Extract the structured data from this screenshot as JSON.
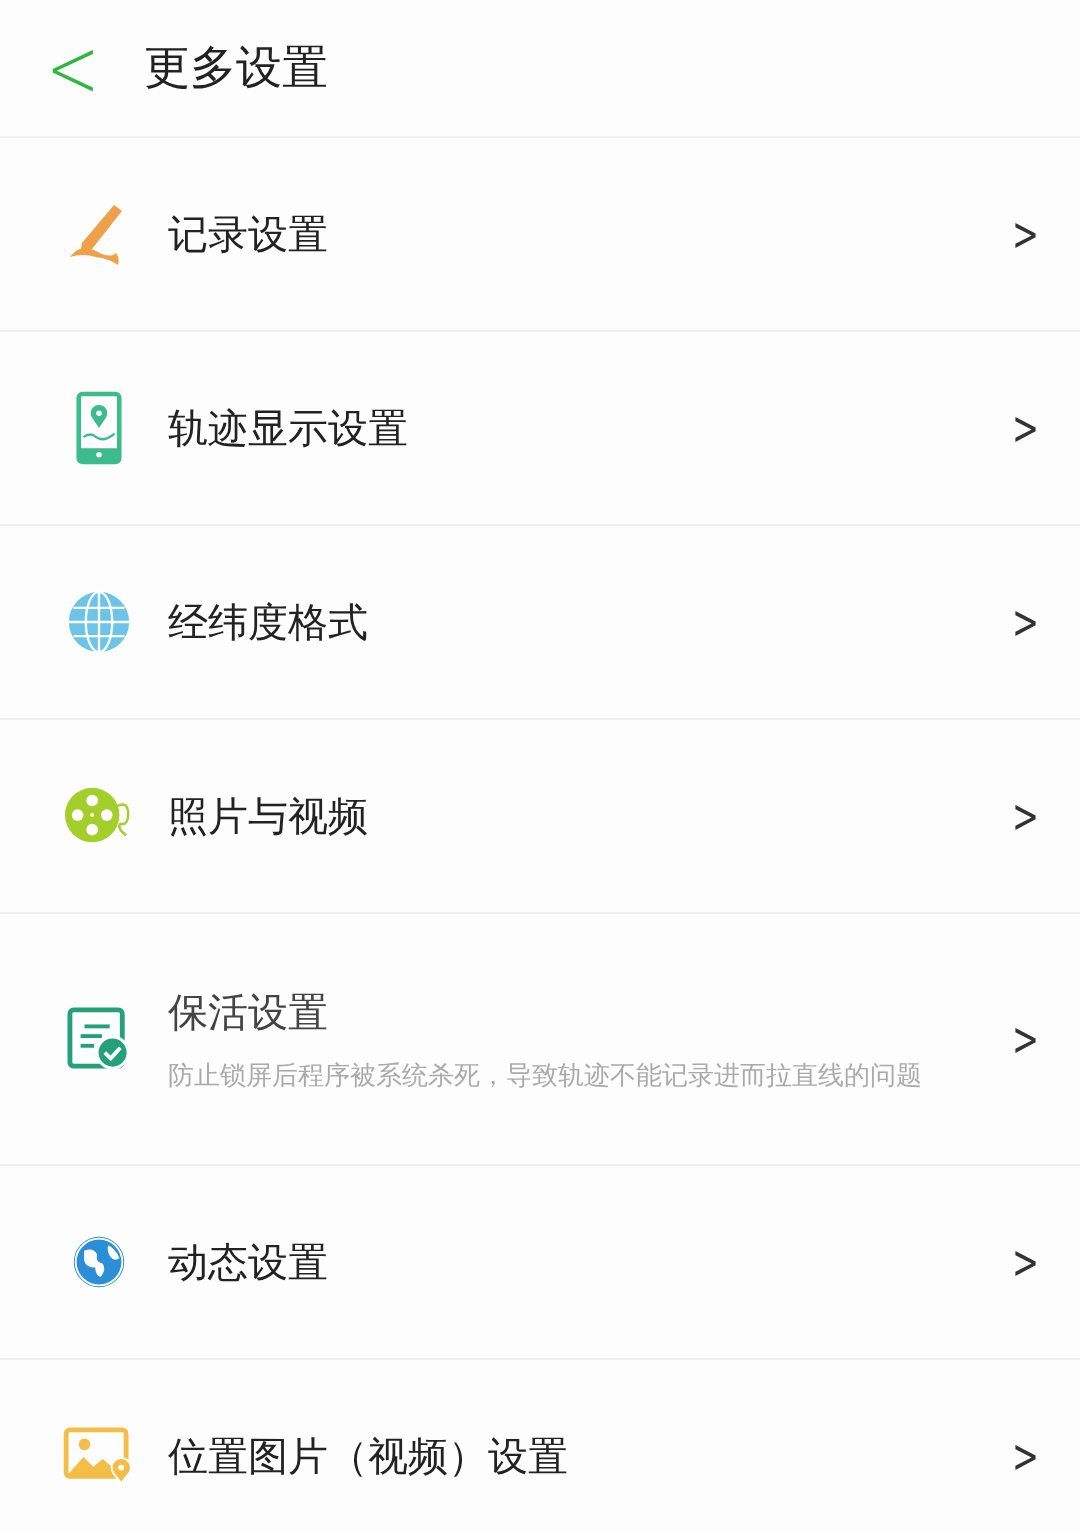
{
  "header": {
    "back": "<",
    "title": "更多设置"
  },
  "items": [
    {
      "kind": "record",
      "label": "记录设置",
      "chevron": ">"
    },
    {
      "kind": "track",
      "label": "轨迹显示设置",
      "chevron": ">"
    },
    {
      "kind": "coords",
      "label": "经纬度格式",
      "chevron": ">"
    },
    {
      "kind": "media",
      "label": "照片与视频",
      "chevron": ">"
    },
    {
      "kind": "keepalive",
      "label": "保活设置",
      "subtitle": "防止锁屏后程序被系统杀死，导致轨迹不能记录进而拉直线的问题",
      "chevron": ">"
    },
    {
      "kind": "moments",
      "label": "动态设置",
      "chevron": ">"
    },
    {
      "kind": "location",
      "label": "位置图片（视频）设置",
      "chevron": ">"
    }
  ]
}
